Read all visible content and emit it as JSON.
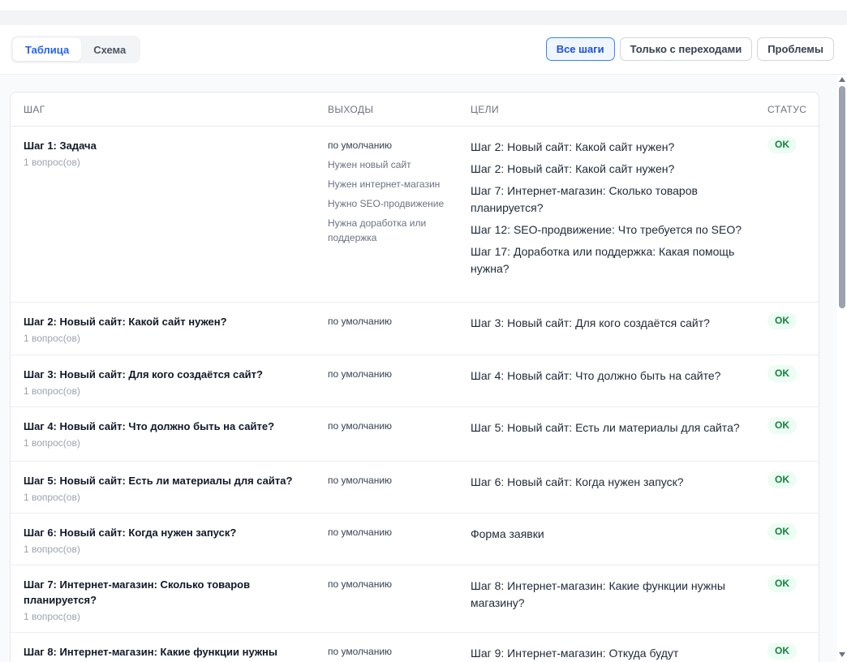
{
  "tabs": [
    {
      "label": "Таблица",
      "active": true
    },
    {
      "label": "Схема",
      "active": false
    }
  ],
  "filters": [
    {
      "label": "Все шаги",
      "active": true
    },
    {
      "label": "Только с переходами",
      "active": false
    },
    {
      "label": "Проблемы",
      "active": false
    }
  ],
  "table": {
    "headers": {
      "step": "ШАГ",
      "exits": "ВЫХОДЫ",
      "targets": "ЦЕЛИ",
      "status": "СТАТУС"
    },
    "rows": [
      {
        "title": "Шаг 1: Задача",
        "sub": "1 вопрос(ов)",
        "exits": [
          "по умолчанию",
          "Нужен новый сайт",
          "Нужен интернет-магазин",
          "Нужно SEO-продвижение",
          "Нужна доработка или поддержка"
        ],
        "targets": [
          "Шаг 2: Новый сайт: Какой сайт нужен?",
          "Шаг 2: Новый сайт: Какой сайт нужен?",
          "Шаг 7: Интернет-магазин: Сколько товаров планируется?",
          "Шаг 12: SEO-продвижение: Что требуется по SEO?",
          "Шаг 17: Доработка или поддержка: Какая помощь нужна?"
        ],
        "status": "OK"
      },
      {
        "title": "Шаг 2: Новый сайт: Какой сайт нужен?",
        "sub": "1 вопрос(ов)",
        "exits": [
          "по умолчанию"
        ],
        "targets": [
          "Шаг 3: Новый сайт: Для кого создаётся сайт?"
        ],
        "status": "OK"
      },
      {
        "title": "Шаг 3: Новый сайт: Для кого создаётся сайт?",
        "sub": "1 вопрос(ов)",
        "exits": [
          "по умолчанию"
        ],
        "targets": [
          "Шаг 4: Новый сайт: Что должно быть на сайте?"
        ],
        "status": "OK"
      },
      {
        "title": "Шаг 4: Новый сайт: Что должно быть на сайте?",
        "sub": "1 вопрос(ов)",
        "exits": [
          "по умолчанию"
        ],
        "targets": [
          "Шаг 5: Новый сайт: Есть ли материалы для сайта?"
        ],
        "status": "OK"
      },
      {
        "title": "Шаг 5: Новый сайт: Есть ли материалы для сайта?",
        "sub": "1 вопрос(ов)",
        "exits": [
          "по умолчанию"
        ],
        "targets": [
          "Шаг 6: Новый сайт: Когда нужен запуск?"
        ],
        "status": "OK"
      },
      {
        "title": "Шаг 6: Новый сайт: Когда нужен запуск?",
        "sub": "1 вопрос(ов)",
        "exits": [
          "по умолчанию"
        ],
        "targets": [
          "Форма заявки"
        ],
        "status": "OK"
      },
      {
        "title": "Шаг 7: Интернет-магазин: Сколько товаров планируется?",
        "sub": "1 вопрос(ов)",
        "exits": [
          "по умолчанию"
        ],
        "targets": [
          "Шаг 8: Интернет-магазин: Какие функции нужны магазину?"
        ],
        "status": "OK"
      },
      {
        "title": "Шаг 8: Интернет-магазин: Какие функции нужны",
        "sub": "",
        "exits": [
          "по умолчанию"
        ],
        "targets": [
          "Шаг 9: Интернет-магазин: Откуда будут"
        ],
        "status": "OK"
      }
    ]
  }
}
